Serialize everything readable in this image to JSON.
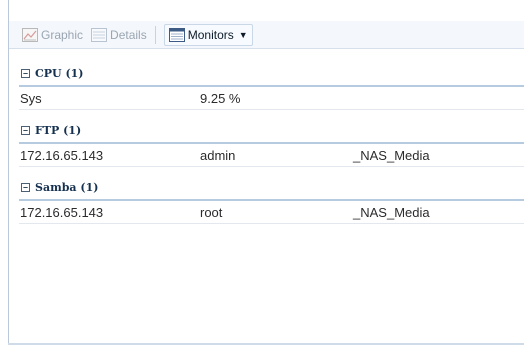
{
  "toolbar": {
    "graphic_label": "Graphic",
    "details_label": "Details",
    "monitors_label": "Monitors"
  },
  "groups": [
    {
      "label": "CPU (1)",
      "rows": [
        [
          "Sys",
          "9.25 %",
          ""
        ]
      ]
    },
    {
      "label": "FTP (1)",
      "rows": [
        [
          "172.16.65.143",
          "admin",
          "_NAS_Media"
        ]
      ]
    },
    {
      "label": "Samba (1)",
      "rows": [
        [
          "172.16.65.143",
          "root",
          "_NAS_Media"
        ]
      ]
    }
  ]
}
